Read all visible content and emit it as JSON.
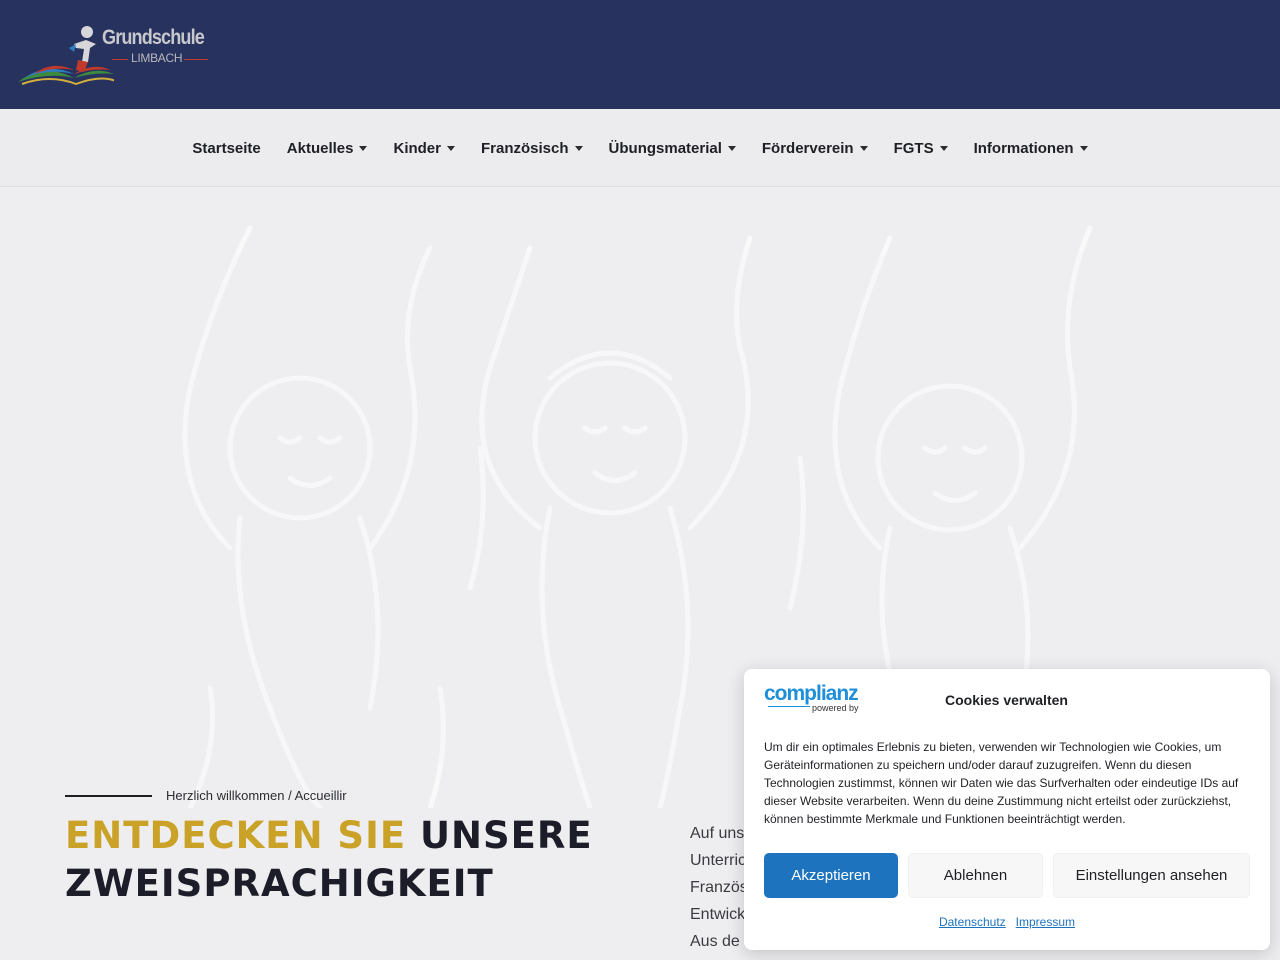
{
  "header": {
    "logo_title": "Grundschule",
    "logo_subtitle": "LIMBACH"
  },
  "nav": {
    "items": [
      {
        "label": "Startseite",
        "dropdown": false
      },
      {
        "label": "Aktuelles",
        "dropdown": true
      },
      {
        "label": "Kinder",
        "dropdown": true
      },
      {
        "label": "Französisch",
        "dropdown": true
      },
      {
        "label": "Übungsmaterial",
        "dropdown": true
      },
      {
        "label": "Förderverein",
        "dropdown": true
      },
      {
        "label": "FGTS",
        "dropdown": true
      },
      {
        "label": "Informationen",
        "dropdown": true
      }
    ]
  },
  "hero": {
    "subtitle": "Herzlich willkommen / Accueillir",
    "headline_accent": "ENTDECKEN SIE",
    "headline_rest": " UNSERE ZWEISPRACHIGKEIT",
    "intro_lines": [
      "Auf uns",
      "Unterric",
      "Französ",
      "Entwick",
      "Aus de"
    ]
  },
  "cookie": {
    "brand": "complianz",
    "brand_sub": "powered by",
    "title": "Cookies verwalten",
    "body": "Um dir ein optimales Erlebnis zu bieten, verwenden wir Technologien wie Cookies, um Geräteinformationen zu speichern und/oder darauf zuzugreifen. Wenn du diesen Technologien zustimmst, können wir Daten wie das Surfverhalten oder eindeutige IDs auf dieser Website verarbeiten. Wenn du deine Zustimmung nicht erteilst oder zurückziehst, können bestimmte Merkmale und Funktionen beeinträchtigt werden.",
    "accept_label": "Akzeptieren",
    "deny_label": "Ablehnen",
    "settings_label": "Einstellungen ansehen",
    "link_privacy": "Datenschutz",
    "link_imprint": "Impressum"
  },
  "colors": {
    "header_bg": "#27325e",
    "accent_gold": "#c9a227",
    "primary_blue": "#1e73be"
  }
}
